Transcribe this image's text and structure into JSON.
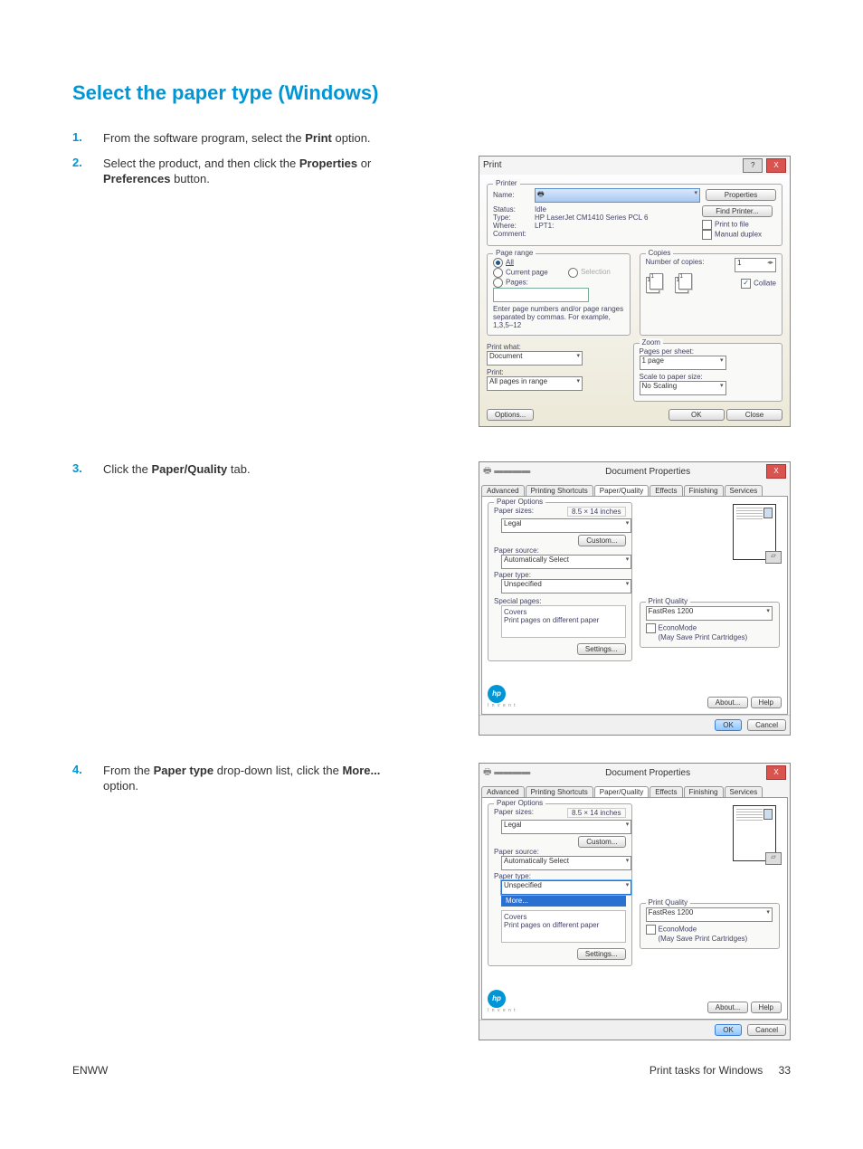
{
  "heading": "Select the paper type (Windows)",
  "steps": [
    {
      "num": "1.",
      "text": "From the software program, select the <b>Print</b> option."
    },
    {
      "num": "2.",
      "text": "Select the product, and then click the <b>Properties</b> or <b>Preferences</b> button."
    },
    {
      "num": "3.",
      "text": "Click the <b>Paper/Quality</b> tab."
    },
    {
      "num": "4.",
      "text": "From the <b>Paper type</b> drop-down list, click the <b>More...</b> option."
    }
  ],
  "print_dialog": {
    "title": "Print",
    "printer_group": "Printer",
    "name_lbl": "Name:",
    "status_lbl": "Status:",
    "status_val": "Idle",
    "type_lbl": "Type:",
    "type_val": "HP LaserJet CM1410 Series PCL 6",
    "where_lbl": "Where:",
    "where_val": "LPT1:",
    "comment_lbl": "Comment:",
    "properties_btn": "Properties",
    "find_printer_btn": "Find Printer...",
    "print_to_file": "Print to file",
    "manual_duplex": "Manual duplex",
    "page_range_group": "Page range",
    "all": "All",
    "current_page": "Current page",
    "selection": "Selection",
    "pages": "Pages:",
    "pages_hint": "Enter page numbers and/or page ranges separated by commas. For example, 1,3,5–12",
    "copies_group": "Copies",
    "num_copies_lbl": "Number of copies:",
    "num_copies_val": "1",
    "collate": "Collate",
    "print_what_lbl": "Print what:",
    "print_what_val": "Document",
    "print_lbl": "Print:",
    "print_val": "All pages in range",
    "zoom_group": "Zoom",
    "pps_lbl": "Pages per sheet:",
    "pps_val": "1 page",
    "scale_lbl": "Scale to paper size:",
    "scale_val": "No Scaling",
    "options_btn": "Options...",
    "ok_btn": "OK",
    "close_btn": "Close"
  },
  "props_dialog": {
    "title": "Document Properties",
    "tabs": [
      "Advanced",
      "Printing Shortcuts",
      "Paper/Quality",
      "Effects",
      "Finishing",
      "Services"
    ],
    "paper_options": "Paper Options",
    "paper_sizes_lbl": "Paper sizes:",
    "paper_sizes_dim": "8.5 × 14 inches",
    "paper_sizes_val": "Legal",
    "custom_btn": "Custom...",
    "paper_source_lbl": "Paper source:",
    "paper_source_val": "Automatically Select",
    "paper_type_lbl": "Paper type:",
    "paper_type_val": "Unspecified",
    "more_option": "More...",
    "special_pages_lbl": "Special pages:",
    "special_pages_items": [
      "Covers",
      "Print pages on different paper"
    ],
    "settings_btn": "Settings...",
    "print_quality_group": "Print Quality",
    "print_quality_val": "FastRes 1200",
    "economode_lbl": "EconoMode",
    "economode_hint": "(May Save Print Cartridges)",
    "about_btn": "About...",
    "help_btn": "Help",
    "ok_btn": "OK",
    "cancel_btn": "Cancel"
  },
  "footer": {
    "left": "ENWW",
    "right_text": "Print tasks for Windows",
    "page_num": "33"
  }
}
